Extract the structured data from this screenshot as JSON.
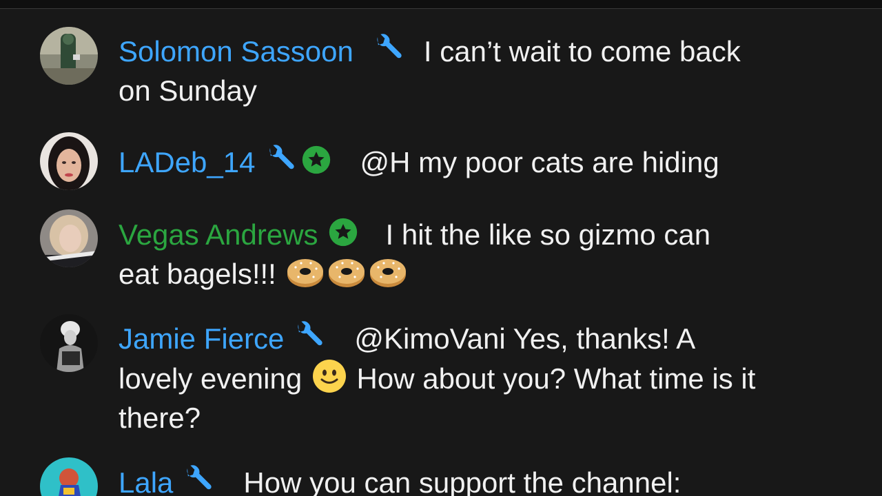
{
  "colors": {
    "background": "#181818",
    "moderator_name": "#3ea6ff",
    "member_name": "#2ba640",
    "wrench_badge": "#3ea6ff",
    "member_badge": "#2ba640",
    "message_text": "#f1f1f1"
  },
  "messages": [
    {
      "author": "Solomon Sassoon",
      "badges": [
        "wrench-icon"
      ],
      "text": "I can’t wait to come back on Sunday",
      "text_part1": "I can’t wait to come back",
      "text_part2": "on Sunday"
    },
    {
      "author": "LADeb_14",
      "badges": [
        "wrench-icon",
        "member-star-icon"
      ],
      "text": "@H my poor cats are hiding"
    },
    {
      "author": "Vegas Andrews",
      "badges": [
        "member-star-icon"
      ],
      "text_part1": "I hit the like so gizmo can",
      "text_part2": "eat bagels!!!",
      "emojis": [
        "bagel-emoji",
        "bagel-emoji",
        "bagel-emoji"
      ]
    },
    {
      "author": "Jamie Fierce",
      "badges": [
        "wrench-icon"
      ],
      "text_part1": "@KimoVani Yes, thanks! A",
      "text_part2": "lovely evening",
      "emoji": "slightly-smiling-face-emoji",
      "text_part3": "How about you? What time is it",
      "text_part4": "there?"
    },
    {
      "author": "Lala",
      "badges": [
        "wrench-icon"
      ],
      "text": "How you can support the channel:"
    }
  ]
}
